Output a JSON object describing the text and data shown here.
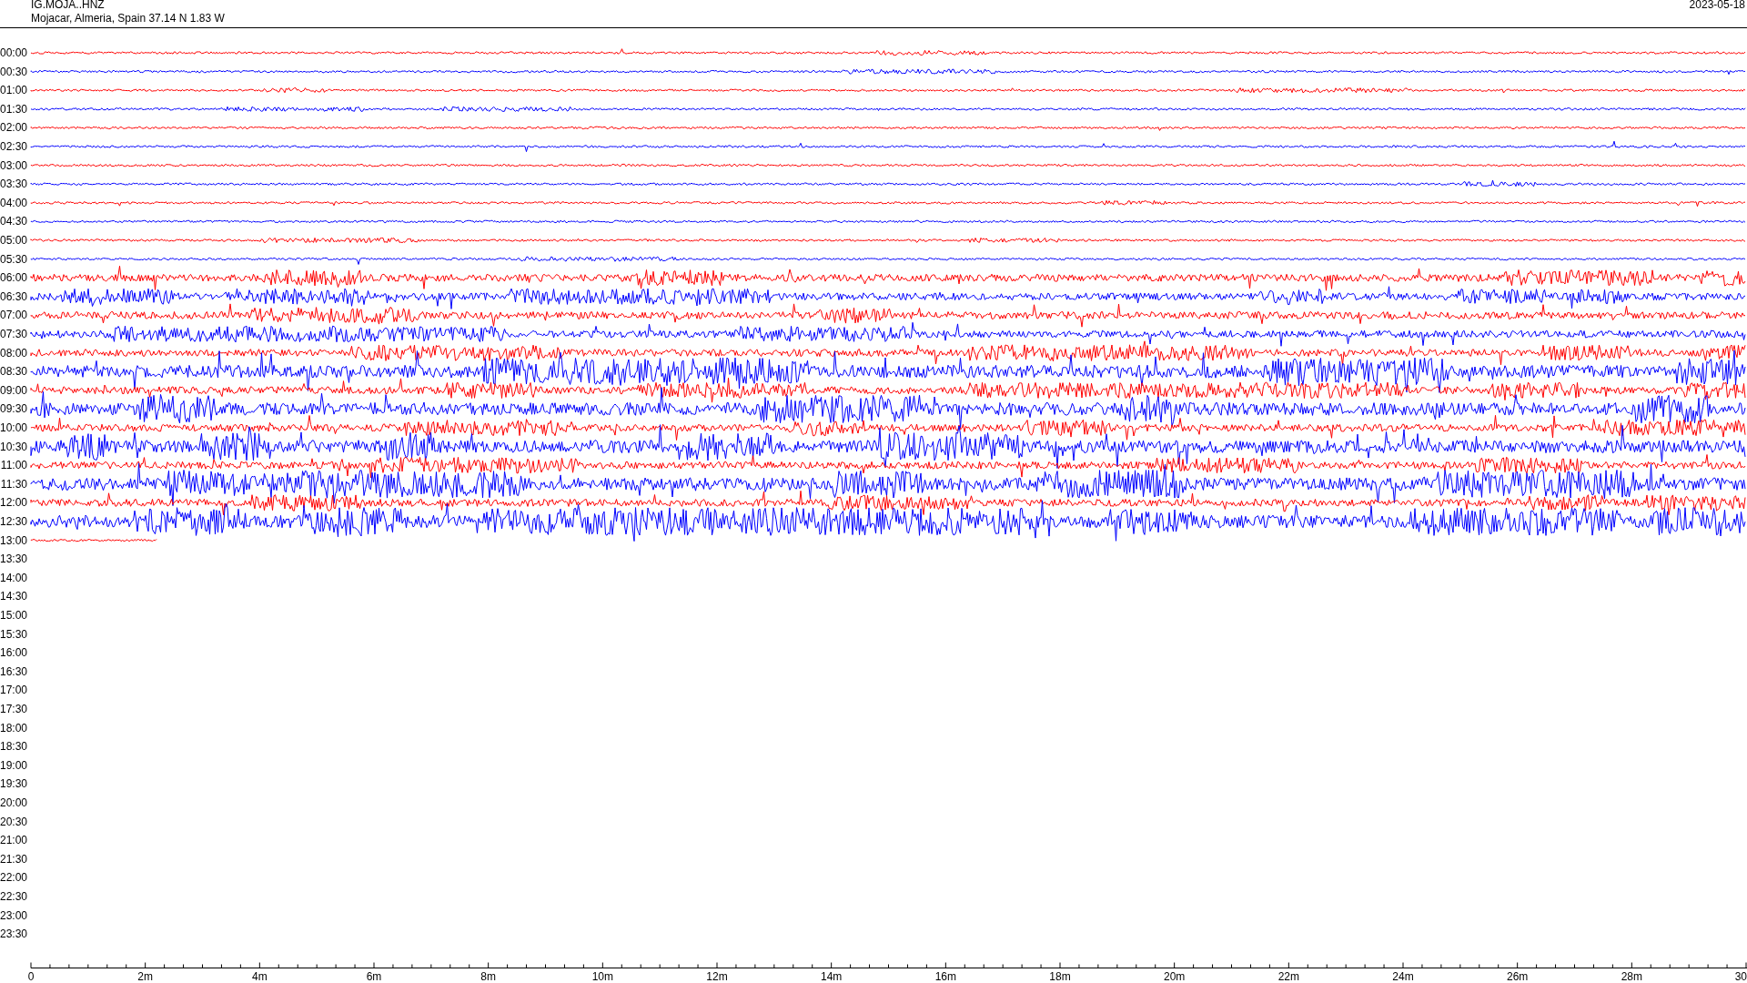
{
  "header": {
    "station": "IG.MOJA..HNZ",
    "location": "Mojacar, Almeria, Spain  37.14 N 1.83 W",
    "date": "2023-05-18"
  },
  "rows": [
    {
      "time": "00:00",
      "color": "#ff0000",
      "kind": "quiet"
    },
    {
      "time": "00:30",
      "color": "#0000ff",
      "kind": "quiet"
    },
    {
      "time": "01:00",
      "color": "#ff0000",
      "kind": "quiet"
    },
    {
      "time": "01:30",
      "color": "#0000ff",
      "kind": "quiet"
    },
    {
      "time": "02:00",
      "color": "#ff0000",
      "kind": "quiet"
    },
    {
      "time": "02:30",
      "color": "#0000ff",
      "kind": "quiet"
    },
    {
      "time": "03:00",
      "color": "#ff0000",
      "kind": "quiet"
    },
    {
      "time": "03:30",
      "color": "#0000ff",
      "kind": "quiet"
    },
    {
      "time": "04:00",
      "color": "#ff0000",
      "kind": "quiet"
    },
    {
      "time": "04:30",
      "color": "#0000ff",
      "kind": "quiet"
    },
    {
      "time": "05:00",
      "color": "#ff0000",
      "kind": "quiet"
    },
    {
      "time": "05:30",
      "color": "#0000ff",
      "kind": "quiet"
    },
    {
      "time": "06:00",
      "color": "#ff0000",
      "kind": "active"
    },
    {
      "time": "06:30",
      "color": "#0000ff",
      "kind": "active"
    },
    {
      "time": "07:00",
      "color": "#ff0000",
      "kind": "active"
    },
    {
      "time": "07:30",
      "color": "#0000ff",
      "kind": "active"
    },
    {
      "time": "08:00",
      "color": "#ff0000",
      "kind": "active"
    },
    {
      "time": "08:30",
      "color": "#0000ff",
      "kind": "strong"
    },
    {
      "time": "09:00",
      "color": "#ff0000",
      "kind": "active"
    },
    {
      "time": "09:30",
      "color": "#0000ff",
      "kind": "strong"
    },
    {
      "time": "10:00",
      "color": "#ff0000",
      "kind": "active"
    },
    {
      "time": "10:30",
      "color": "#0000ff",
      "kind": "strong"
    },
    {
      "time": "11:00",
      "color": "#ff0000",
      "kind": "active"
    },
    {
      "time": "11:30",
      "color": "#0000ff",
      "kind": "strong"
    },
    {
      "time": "12:00",
      "color": "#ff0000",
      "kind": "active"
    },
    {
      "time": "12:30",
      "color": "#0000ff",
      "kind": "strong"
    },
    {
      "time": "13:00",
      "color": "#ff0000",
      "kind": "partial"
    },
    {
      "time": "13:30",
      "kind": "empty"
    },
    {
      "time": "14:00",
      "kind": "empty"
    },
    {
      "time": "14:30",
      "kind": "empty"
    },
    {
      "time": "15:00",
      "kind": "empty"
    },
    {
      "time": "15:30",
      "kind": "empty"
    },
    {
      "time": "16:00",
      "kind": "empty"
    },
    {
      "time": "16:30",
      "kind": "empty"
    },
    {
      "time": "17:00",
      "kind": "empty"
    },
    {
      "time": "17:30",
      "kind": "empty"
    },
    {
      "time": "18:00",
      "kind": "empty"
    },
    {
      "time": "18:30",
      "kind": "empty"
    },
    {
      "time": "19:00",
      "kind": "empty"
    },
    {
      "time": "19:30",
      "kind": "empty"
    },
    {
      "time": "20:00",
      "kind": "empty"
    },
    {
      "time": "20:30",
      "kind": "empty"
    },
    {
      "time": "21:00",
      "kind": "empty"
    },
    {
      "time": "21:30",
      "kind": "empty"
    },
    {
      "time": "22:00",
      "kind": "empty"
    },
    {
      "time": "22:30",
      "kind": "empty"
    },
    {
      "time": "23:00",
      "kind": "empty"
    },
    {
      "time": "23:30",
      "kind": "empty"
    }
  ],
  "axis": {
    "labels": [
      "0",
      "2m",
      "4m",
      "6m",
      "8m",
      "10m",
      "12m",
      "14m",
      "16m",
      "18m",
      "20m",
      "22m",
      "24m",
      "26m",
      "28m",
      "30"
    ]
  }
}
